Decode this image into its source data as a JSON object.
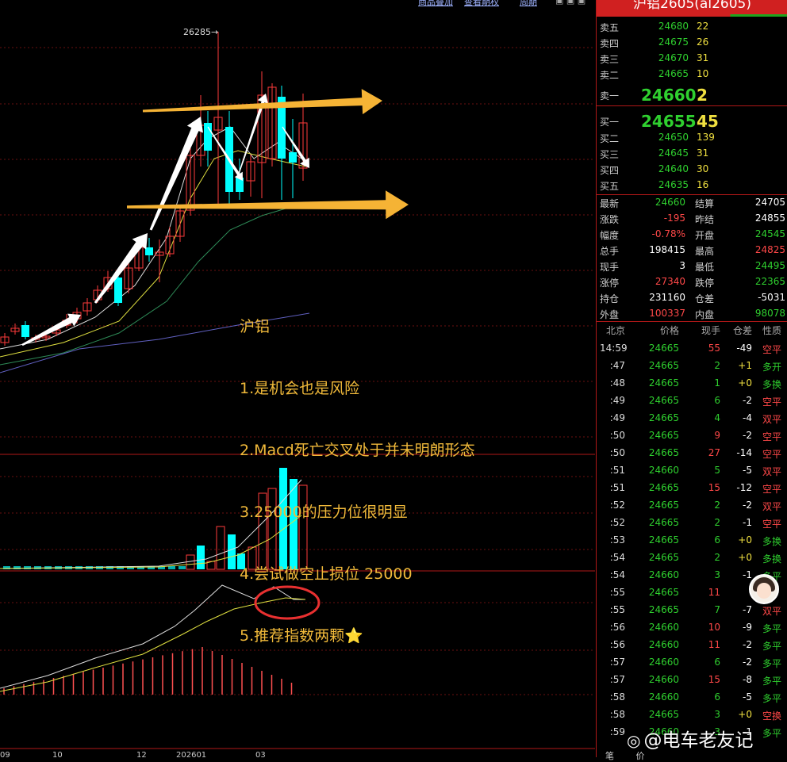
{
  "header_links": [
    "商品叠加",
    "查看期权",
    "周期"
  ],
  "chart": {
    "high_marker": "26285",
    "date_labels": [
      "09",
      "10",
      "12",
      "202601",
      "03"
    ],
    "annotation_lines": [
      "沪铝",
      "1.是机会也是风险",
      "2.Macd死亡交叉处于并未明朗形态",
      "3.25000的压力位很明显",
      "4.尝试做空止损位 25000",
      "5.推荐指数两颗⭐"
    ],
    "colors": {
      "up": "#ff3b3b",
      "down": "#00ffff",
      "arrow_white": "#ffffff",
      "arrow_orange": "#f5b335",
      "circle": "#e83030"
    }
  },
  "panel": {
    "title": "沪铝2605(al2605)",
    "asks": [
      {
        "label": "卖五",
        "price": "24680",
        "vol": "22"
      },
      {
        "label": "卖四",
        "price": "24675",
        "vol": "26"
      },
      {
        "label": "卖三",
        "price": "24670",
        "vol": "31"
      },
      {
        "label": "卖二",
        "price": "24665",
        "vol": "10"
      },
      {
        "label": "卖一",
        "price": "24660",
        "vol": "2"
      }
    ],
    "bids": [
      {
        "label": "买一",
        "price": "24655",
        "vol": "45"
      },
      {
        "label": "买二",
        "price": "24650",
        "vol": "139"
      },
      {
        "label": "买三",
        "price": "24645",
        "vol": "31"
      },
      {
        "label": "买四",
        "price": "24640",
        "vol": "30"
      },
      {
        "label": "买五",
        "price": "24635",
        "vol": "16"
      }
    ],
    "stats": [
      {
        "l1": "最新",
        "v1": "24660",
        "l2": "结算",
        "v2": "24705"
      },
      {
        "l1": "涨跌",
        "v1": "-195",
        "l2": "昨结",
        "v2": "24855"
      },
      {
        "l1": "幅度",
        "v1": "-0.78%",
        "l2": "开盘",
        "v2": "24545"
      },
      {
        "l1": "总手",
        "v1": "198415",
        "l2": "最高",
        "v2": "24825"
      },
      {
        "l1": "现手",
        "v1": "3",
        "l2": "最低",
        "v2": "24495"
      },
      {
        "l1": "涨停",
        "v1": "27340",
        "l2": "跌停",
        "v2": "22365"
      },
      {
        "l1": "持仓",
        "v1": "231160",
        "l2": "仓差",
        "v2": "-5031"
      },
      {
        "l1": "外盘",
        "v1": "100337",
        "l2": "内盘",
        "v2": "98078"
      }
    ],
    "tick_header": [
      "北京",
      "价格",
      "现手",
      "仓差",
      "性质"
    ],
    "ticks": [
      {
        "t": "14:59",
        "p": "24665",
        "v": "55",
        "d": "-49",
        "n": "空平"
      },
      {
        "t": ":47",
        "p": "24665",
        "v": "2",
        "d": "+1",
        "n": "多开"
      },
      {
        "t": ":48",
        "p": "24665",
        "v": "1",
        "d": "+0",
        "n": "多换"
      },
      {
        "t": ":49",
        "p": "24665",
        "v": "6",
        "d": "-2",
        "n": "空平"
      },
      {
        "t": ":49",
        "p": "24665",
        "v": "4",
        "d": "-4",
        "n": "双平"
      },
      {
        "t": ":50",
        "p": "24665",
        "v": "9",
        "d": "-2",
        "n": "空平"
      },
      {
        "t": ":50",
        "p": "24665",
        "v": "27",
        "d": "-14",
        "n": "空平"
      },
      {
        "t": ":51",
        "p": "24660",
        "v": "5",
        "d": "-5",
        "n": "双平"
      },
      {
        "t": ":51",
        "p": "24665",
        "v": "15",
        "d": "-12",
        "n": "空平"
      },
      {
        "t": ":52",
        "p": "24665",
        "v": "2",
        "d": "-2",
        "n": "双平"
      },
      {
        "t": ":52",
        "p": "24665",
        "v": "2",
        "d": "-1",
        "n": "空平"
      },
      {
        "t": ":53",
        "p": "24665",
        "v": "6",
        "d": "+0",
        "n": "多换"
      },
      {
        "t": ":54",
        "p": "24665",
        "v": "2",
        "d": "+0",
        "n": "多换"
      },
      {
        "t": ":54",
        "p": "24660",
        "v": "3",
        "d": "-1",
        "n": "多平"
      },
      {
        "t": ":55",
        "p": "24665",
        "v": "11",
        "d": "",
        "n": ""
      },
      {
        "t": ":55",
        "p": "24665",
        "v": "7",
        "d": "-7",
        "n": "双平"
      },
      {
        "t": ":56",
        "p": "24660",
        "v": "10",
        "d": "-9",
        "n": "多平"
      },
      {
        "t": ":56",
        "p": "24660",
        "v": "11",
        "d": "-2",
        "n": "多平"
      },
      {
        "t": ":57",
        "p": "24660",
        "v": "6",
        "d": "-2",
        "n": "多平"
      },
      {
        "t": ":57",
        "p": "24660",
        "v": "15",
        "d": "-8",
        "n": "多平"
      },
      {
        "t": ":58",
        "p": "24660",
        "v": "6",
        "d": "-5",
        "n": "多平"
      },
      {
        "t": ":58",
        "p": "24665",
        "v": "3",
        "d": "+0",
        "n": "空换"
      },
      {
        "t": ":59",
        "p": "24660",
        "v": "3",
        "d": "-1",
        "n": "多平"
      }
    ],
    "bottom_tabs": [
      "笔",
      "价"
    ]
  },
  "watermark": "@电车老友记"
}
